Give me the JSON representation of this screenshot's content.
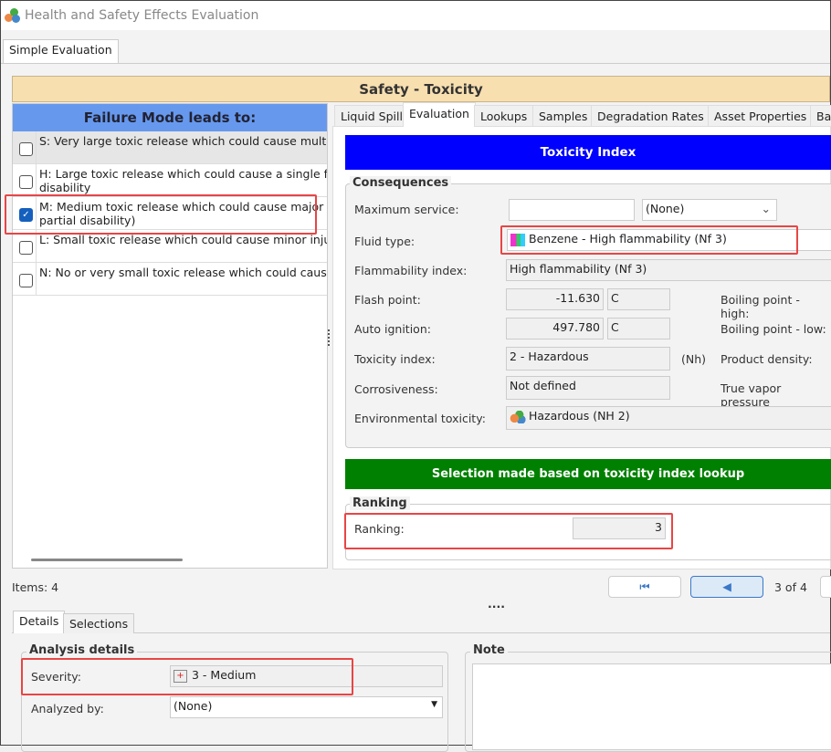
{
  "window": {
    "title": "Health and Safety Effects Evaluation"
  },
  "main_tab": "Simple Evaluation",
  "section_title": "Safety - Toxicity",
  "failure_modes": {
    "header": "Failure Mode leads to:",
    "items": [
      {
        "text": "S: Very large toxic release which could cause multiple",
        "checked": false
      },
      {
        "text": "H: Large toxic release which could cause a single fata",
        "text2": "disability",
        "checked": false
      },
      {
        "text": "M: Medium toxic release which could cause major inju",
        "text2": "partial disability)",
        "checked": true
      },
      {
        "text": "L: Small toxic release which could cause minor injuries",
        "checked": false
      },
      {
        "text": "N: No or very small toxic release which could cause c",
        "checked": false
      }
    ]
  },
  "tabs": [
    "Liquid Spill",
    "Evaluation",
    "Lookups",
    "Samples",
    "Degradation Rates",
    "Asset Properties",
    "Ba"
  ],
  "toxicity_banner": "Toxicity Index",
  "consequences": {
    "title": "Consequences",
    "max_service_label": "Maximum service:",
    "max_service_value": "",
    "max_service_unit": "(None)",
    "fluid_type_label": "Fluid type:",
    "fluid_type": "Benzene - High flammability (Nf 3)",
    "flammability_label": "Flammability index:",
    "flammability": "High flammability (Nf 3)",
    "flash_label": "Flash point:",
    "flash": "-11.630",
    "flash_unit": "C",
    "auto_label": "Auto ignition:",
    "auto": "497.780",
    "auto_unit": "C",
    "toxicity_label": "Toxicity index:",
    "toxicity": "2 - Hazardous",
    "toxicity_code": "(Nh)",
    "corrosive_label": "Corrosiveness:",
    "corrosive": "Not defined",
    "env_label": "Environmental toxicity:",
    "env": "Hazardous (NH 2)",
    "bp_high": "Boiling point - high:",
    "bp_low": "Boiling point - low:",
    "density": "Product density:",
    "tvp": "True vapor pressure"
  },
  "selection_banner": "Selection made based on toxicity index lookup",
  "ranking": {
    "title": "Ranking",
    "label": "Ranking:",
    "value": "3"
  },
  "items_count": "Items: 4",
  "pager": "3 of 4",
  "splitter": "....",
  "bottom_tabs": [
    "Details",
    "Selections"
  ],
  "analysis": {
    "title": "Analysis details",
    "severity_label": "Severity:",
    "severity": "3 - Medium",
    "analyzed_label": "Analyzed by:",
    "analyzed": "(None)"
  },
  "note": {
    "title": "Note"
  }
}
